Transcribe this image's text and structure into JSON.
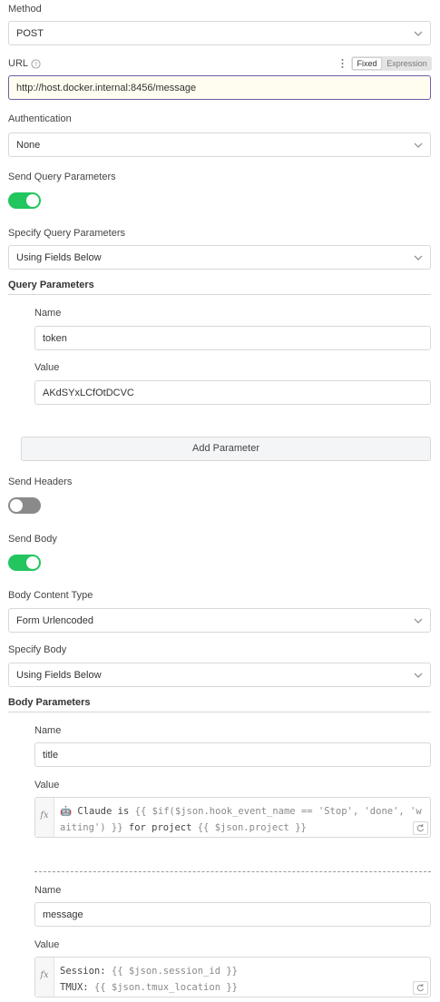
{
  "method": {
    "label": "Method",
    "value": "POST"
  },
  "url": {
    "label": "URL",
    "value": "http://host.docker.internal:8456/message",
    "mode_options": [
      "Fixed",
      "Expression"
    ],
    "mode_selected": "Fixed"
  },
  "authentication": {
    "label": "Authentication",
    "value": "None"
  },
  "send_query": {
    "label": "Send Query Parameters",
    "enabled": true
  },
  "specify_query": {
    "label": "Specify Query Parameters",
    "value": "Using Fields Below"
  },
  "query_parameters": {
    "heading": "Query Parameters",
    "name_label": "Name",
    "name_value": "token",
    "value_label": "Value",
    "value_value": "AKdSYxLCfOtDCVC",
    "add_button": "Add Parameter"
  },
  "send_headers": {
    "label": "Send Headers",
    "enabled": false
  },
  "send_body": {
    "label": "Send Body",
    "enabled": true
  },
  "body_content_type": {
    "label": "Body Content Type",
    "value": "Form Urlencoded"
  },
  "specify_body": {
    "label": "Specify Body",
    "value": "Using Fields Below"
  },
  "body_parameters": {
    "heading": "Body Parameters",
    "items": [
      {
        "name_label": "Name",
        "name_value": "title",
        "value_label": "Value",
        "line1_text": "🤖 Claude is ",
        "line1_expr": "{{ $if($json.hook_event_name == 'Stop', 'done', 'w",
        "line2_expr": "aiting') }}",
        "line2_text": " for project ",
        "line2_expr2": "{{ $json.project }}"
      },
      {
        "name_label": "Name",
        "name_value": "message",
        "value_label": "Value",
        "line1_text": "Session: ",
        "line1_expr": "{{ $json.session_id }}",
        "line2_text": "TMUX: ",
        "line2_expr": "{{ $json.tmux_location }}"
      }
    ]
  },
  "icons": {
    "fx": "fx",
    "chevron": "chevron-down-icon",
    "help": "help-circle-icon",
    "more": "more-vertical-icon",
    "refresh": "refresh-icon"
  },
  "colors": {
    "toggle_on": "#22c55e",
    "toggle_off": "#8a8a8a",
    "url_border": "#6b5fa8",
    "url_bg": "#fffdf0"
  }
}
